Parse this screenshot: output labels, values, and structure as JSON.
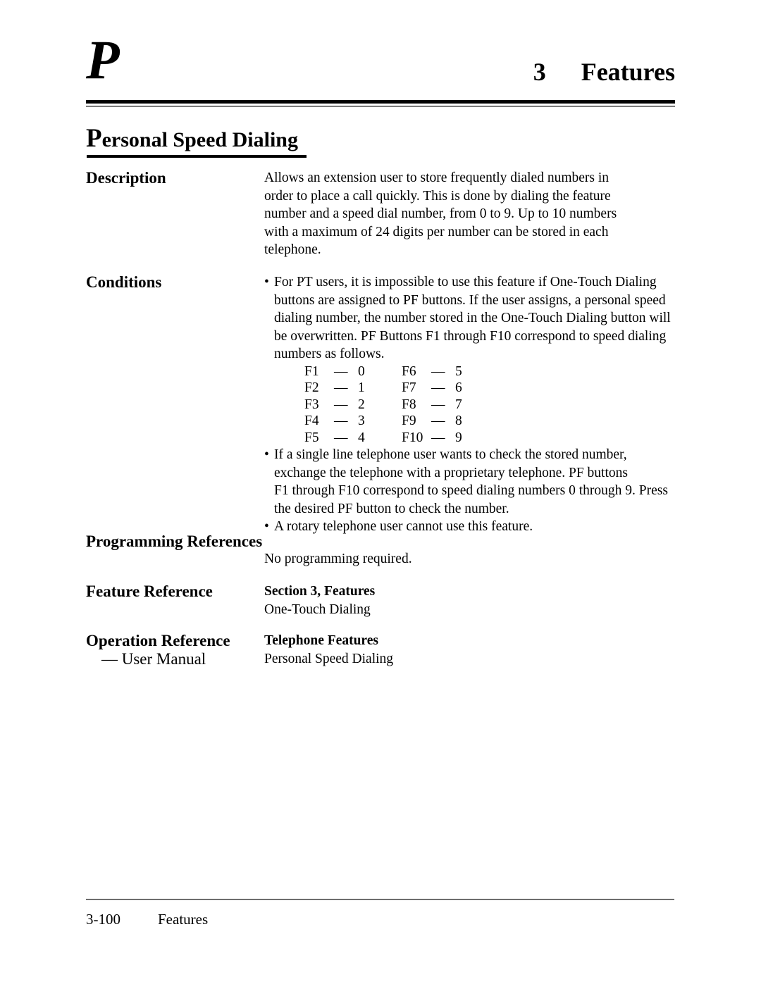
{
  "header": {
    "dropcap": "P",
    "chapter_number": "3",
    "chapter_title": "Features"
  },
  "title": {
    "cap": "P",
    "rest": "ersonal Speed Dialing"
  },
  "sections": {
    "description": {
      "label": "Description",
      "paragraph": "Allows an extension user to store frequently dialed numbers in order to place a call quickly. This is done by dialing the feature number and a speed dial number, from 0 to 9. Up to 10 numbers with a maximum of 24 digits per number can be stored in each telephone.",
      "lines": [
        "Allows an extension user to store frequently dialed numbers in",
        "order to place a call quickly. This is done by dialing the feature",
        "number and a speed dial number, from 0 to 9. Up to 10 numbers",
        "with a maximum of 24 digits per number can be stored in each",
        "telephone."
      ]
    },
    "conditions": {
      "label": "Conditions",
      "bullet_char": "•",
      "bullets": [
        {
          "text": "For PT users, it is impossible to use this feature if One-Touch Dialing buttons are assigned to PF buttons. If the user assigns, a personal speed dialing number, the number stored in the One-Touch Dialing button will be overwritten. PF Buttons F1 through F10 correspond to speed dialing numbers as follows.",
          "lines": [
            "For PT users, it is impossible to use this feature if One-Touch Dialing",
            "buttons are assigned to PF buttons. If the user assigns, a personal speed",
            "dialing number, the number stored in the One-Touch Dialing button will",
            "be overwritten. PF Buttons F1 through F10 correspond to speed dialing",
            "numbers as follows."
          ]
        },
        {
          "text": "If a single line telephone user wants to check the stored number, exchange the telephone with a proprietary telephone. PF buttons F1 through F10 correspond to speed dialing numbers 0 through 9. Press the desired PF button to check the number.",
          "lines": [
            "If a single line telephone user wants to check the stored number,",
            "exchange the telephone with a proprietary telephone. PF buttons",
            "F1 through F10 correspond to speed dialing numbers 0 through 9. Press",
            "the desired PF button to check the number."
          ]
        },
        {
          "text": "A rotary telephone user cannot use this feature.",
          "lines": [
            "A rotary telephone user cannot use this feature."
          ]
        }
      ],
      "fkey_map": {
        "dash": "—",
        "rows": [
          {
            "left_key": "F1",
            "left_value": "0",
            "right_key": "F6",
            "right_value": "5"
          },
          {
            "left_key": "F2",
            "left_value": "1",
            "right_key": "F7",
            "right_value": "6"
          },
          {
            "left_key": "F3",
            "left_value": "2",
            "right_key": "F8",
            "right_value": "7"
          },
          {
            "left_key": "F4",
            "left_value": "3",
            "right_key": "F9",
            "right_value": "8"
          },
          {
            "left_key": "F5",
            "left_value": "4",
            "right_key": "F10",
            "right_value": "9"
          }
        ]
      }
    },
    "programming_references": {
      "label": "Programming References",
      "body": "No programming required."
    },
    "feature_reference": {
      "label": "Feature Reference",
      "body_bold": "Section 3, Features",
      "body_plain": "One-Touch Dialing"
    },
    "operation_reference": {
      "label": "Operation Reference",
      "sublabel": "— User Manual",
      "body_bold": "Telephone Features",
      "body_plain": "Personal Speed Dialing"
    }
  },
  "footer": {
    "page_number": "3-100",
    "section_name": "Features"
  }
}
